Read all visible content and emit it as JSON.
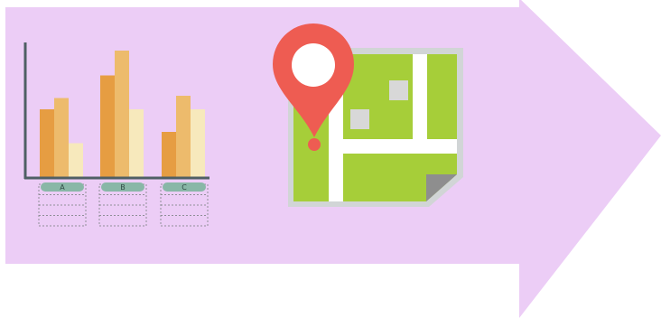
{
  "colors": {
    "arrow": "#eccdf6",
    "axis": "#4f5f64",
    "bar_dark": "#e69d42",
    "bar_mid": "#edbb6c",
    "bar_light": "#f7e9bc",
    "pill": "#89b7a7",
    "map_green": "#a6ce39",
    "map_border": "#d1d5d6",
    "map_fold": "#8e8e8e",
    "pin": "#ee5c52"
  },
  "chart": {
    "categories": [
      "A",
      "B",
      "C"
    ],
    "values": [
      [
        3,
        3.5,
        1.5
      ],
      [
        4.5,
        5.6,
        3
      ],
      [
        2,
        3.6,
        3
      ]
    ],
    "rows_per_category": 3
  },
  "icons": [
    "map-icon",
    "location-pin-icon"
  ]
}
